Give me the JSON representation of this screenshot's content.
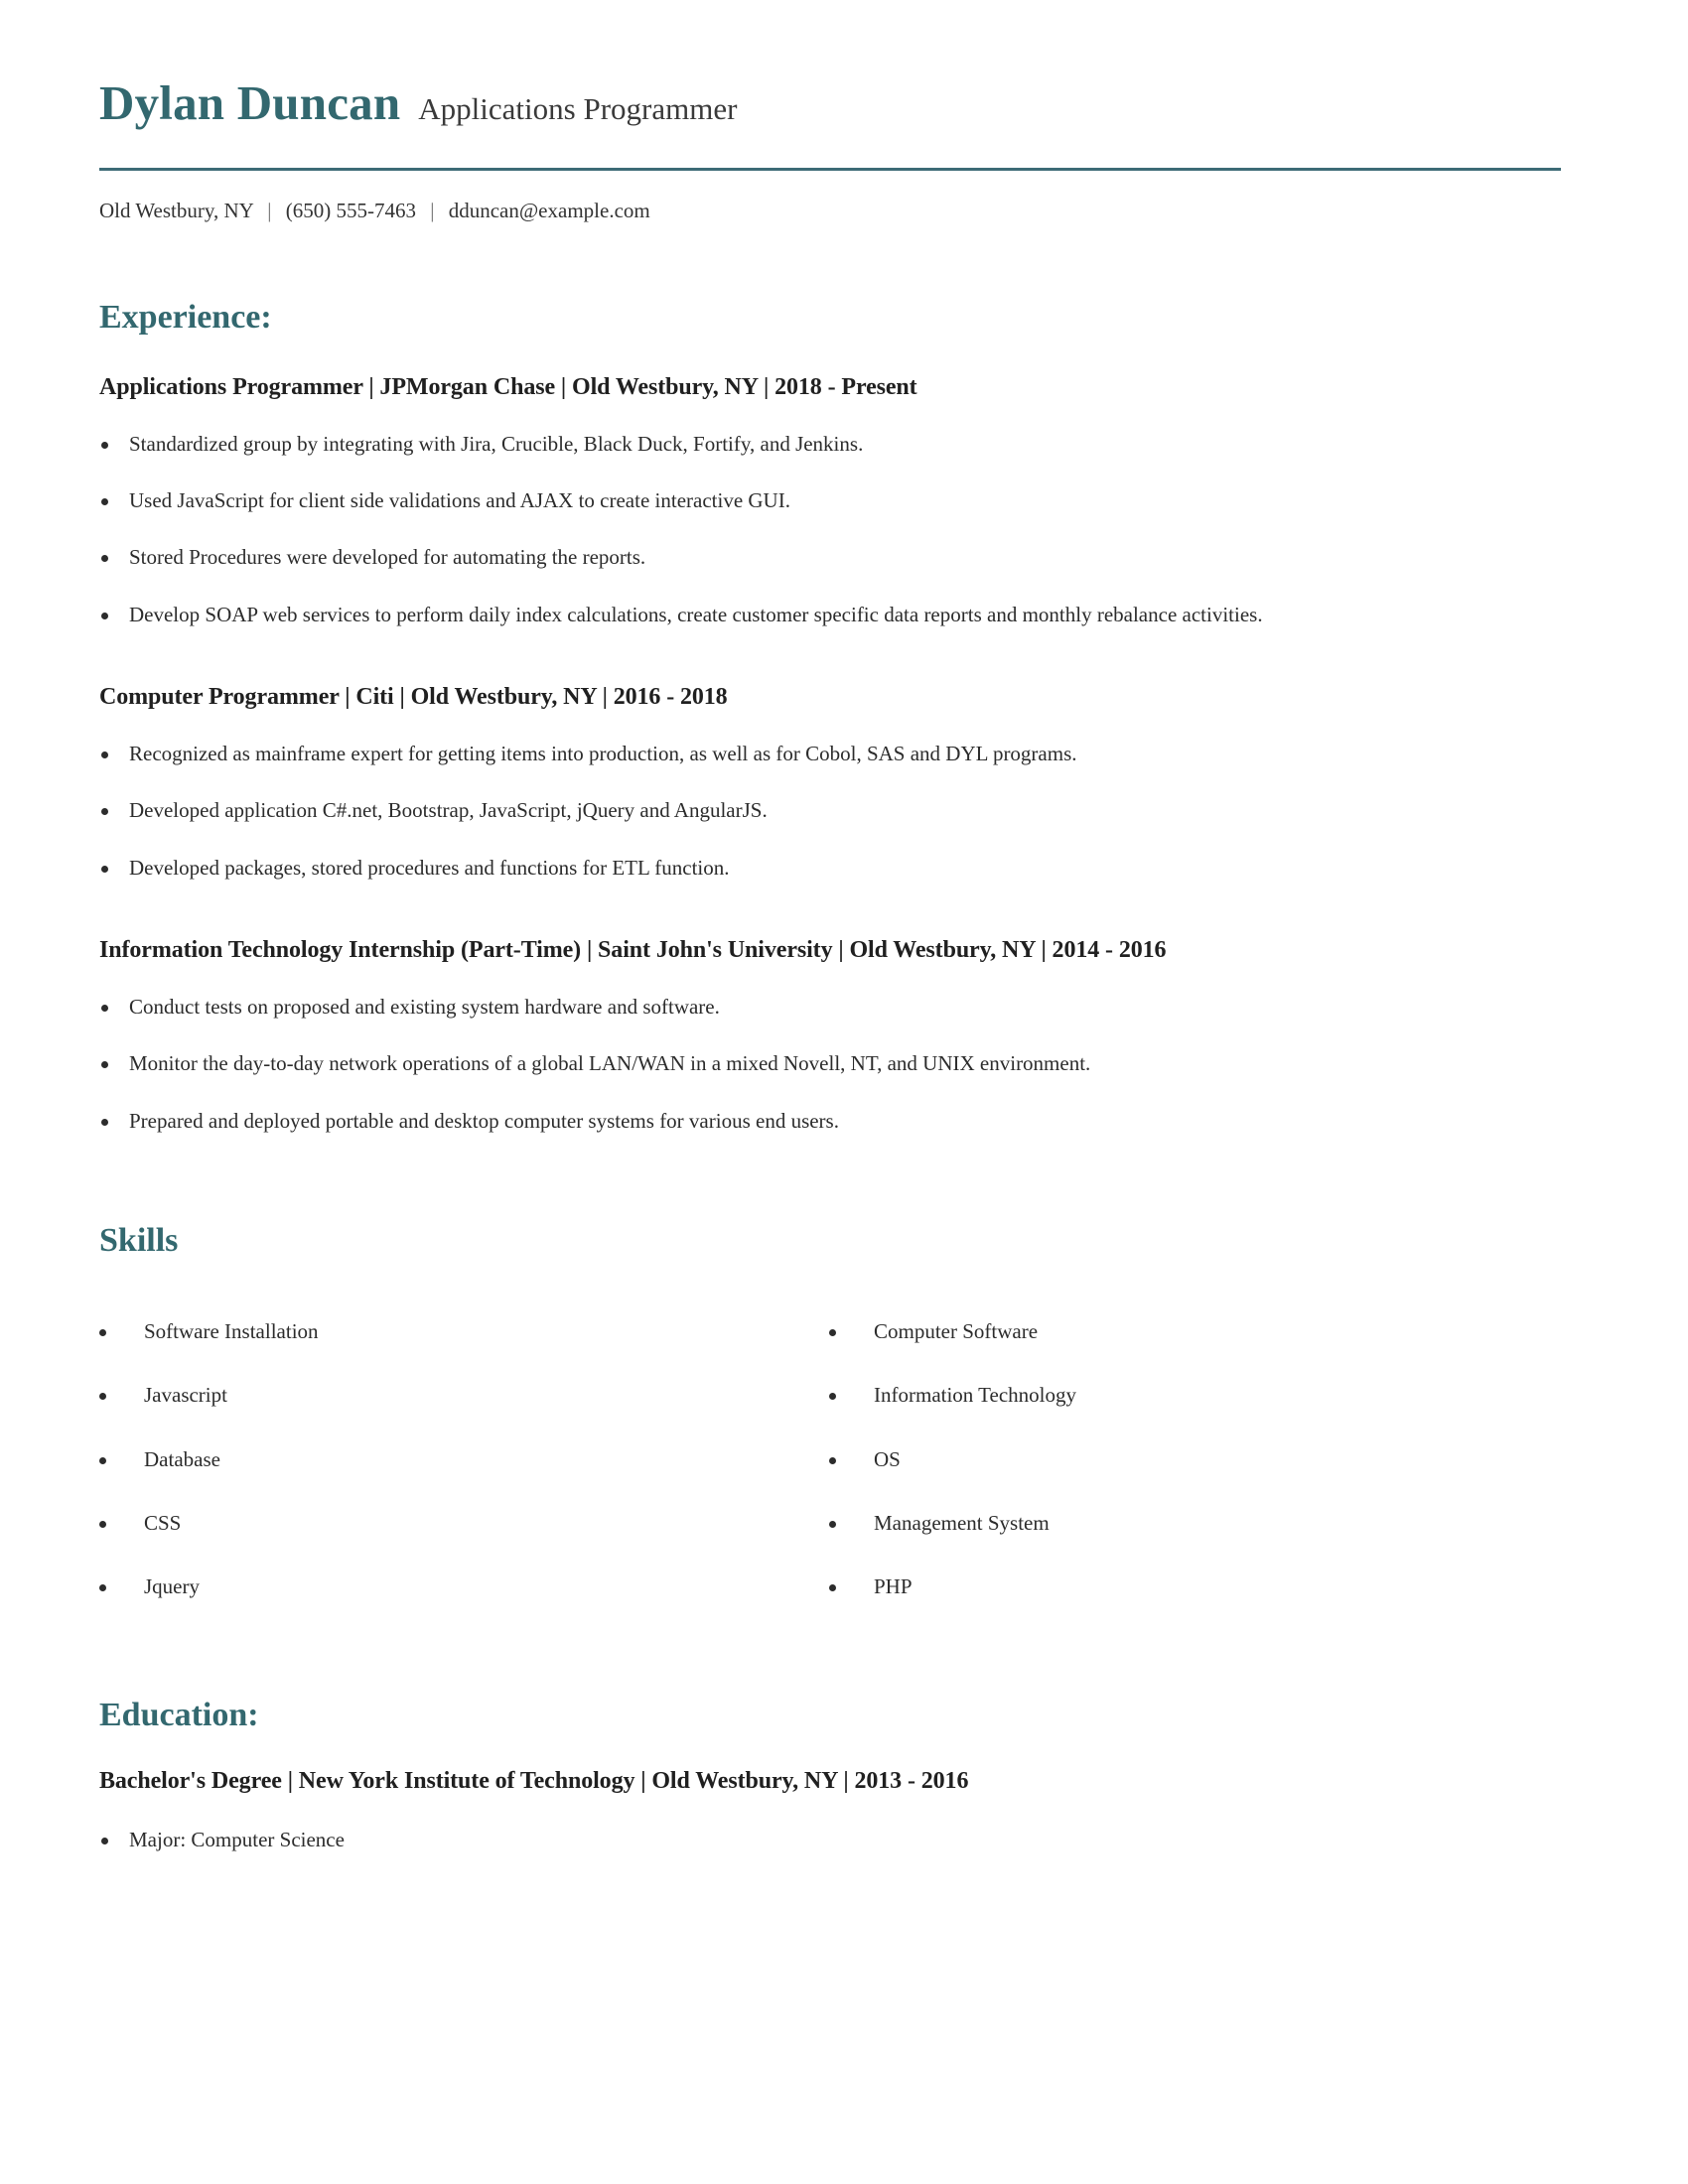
{
  "header": {
    "name": "Dylan Duncan",
    "job_title": "Applications Programmer",
    "separator": "|",
    "contact": {
      "location": "Old Westbury, NY",
      "phone": "(650) 555-7463",
      "email": "dduncan@example.com"
    },
    "accent_color": "#33686f",
    "rule_color": "#3d6b76"
  },
  "experience": {
    "heading": "Experience:",
    "entries": [
      {
        "heading": "Applications Programmer | JPMorgan Chase | Old Westbury, NY | 2018 - Present",
        "bullets": [
          "Standardized group by integrating with Jira, Crucible, Black Duck, Fortify, and Jenkins.",
          "Used JavaScript for client side validations and AJAX to create interactive GUI.",
          "Stored Procedures were developed for automating the reports.",
          "Develop SOAP web services to perform daily index calculations, create customer specific data reports and monthly rebalance activities."
        ]
      },
      {
        "heading": "Computer Programmer | Citi | Old Westbury, NY | 2016 - 2018",
        "bullets": [
          "Recognized as mainframe expert for getting items into production, as well as for Cobol, SAS and DYL programs.",
          "Developed application C#.net, Bootstrap, JavaScript, jQuery and AngularJS.",
          "Developed packages, stored procedures and functions for ETL function."
        ]
      },
      {
        "heading": "Information Technology Internship (Part-Time) | Saint John's University | Old Westbury, NY | 2014 - 2016",
        "bullets": [
          "Conduct tests on proposed and existing system hardware and software.",
          "Monitor the day-to-day network operations of a global LAN/WAN in a mixed Novell, NT, and UNIX environment.",
          "Prepared and deployed portable and desktop computer systems for various end users."
        ]
      }
    ]
  },
  "skills": {
    "heading": "Skills",
    "left_column": [
      "Software Installation",
      "Javascript",
      "Database",
      "CSS",
      "Jquery"
    ],
    "right_column": [
      "Computer Software",
      "Information Technology",
      "OS",
      "Management System",
      "PHP"
    ]
  },
  "education": {
    "heading": "Education:",
    "entries": [
      {
        "heading": "Bachelor's Degree | New York Institute of Technology | Old Westbury, NY | 2013 - 2016",
        "bullets": [
          "Major: Computer Science"
        ]
      }
    ]
  }
}
